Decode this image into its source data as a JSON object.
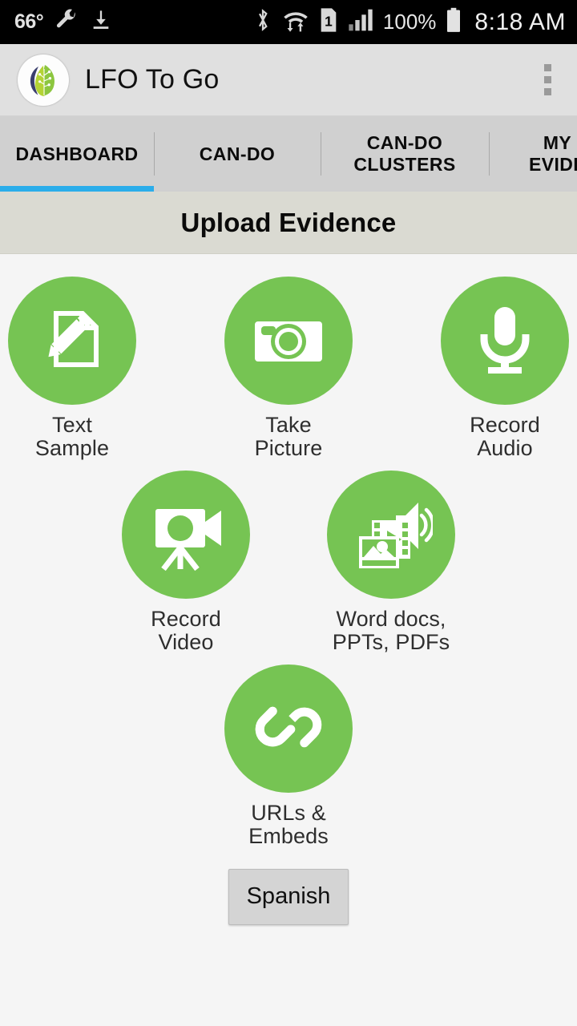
{
  "status_bar": {
    "temperature": "66°",
    "icons_left": [
      "wrench-icon",
      "download-icon"
    ],
    "icons_right": [
      "bluetooth-icon",
      "wifi-icon",
      "sim-1-icon",
      "signal-icon"
    ],
    "sim_label": "1",
    "battery_percent": "100%",
    "time": "8:18 AM"
  },
  "app_bar": {
    "title": "LFO To Go",
    "logo_name": "lfo-leaf-logo",
    "overflow_label": "More options"
  },
  "tabs": [
    {
      "label": "DASHBOARD",
      "active": true
    },
    {
      "label": "CAN-DO",
      "active": false
    },
    {
      "label": "CAN-DO CLUSTERS",
      "active": false
    },
    {
      "label": "MY EVIDE",
      "active": false
    }
  ],
  "tab_labels": {
    "dashboard": "DASHBOARD",
    "cando": "CAN-DO",
    "clusters_line1": "CAN-DO",
    "clusters_line2": "CLUSTERS",
    "evidence_line1": "MY",
    "evidence_line2": "EVIDE"
  },
  "section": {
    "title": "Upload Evidence"
  },
  "tiles": [
    {
      "id": "text-sample",
      "icon": "document-pencil-icon",
      "line1": "Text",
      "line2": "Sample"
    },
    {
      "id": "take-picture",
      "icon": "camera-icon",
      "line1": "Take",
      "line2": "Picture"
    },
    {
      "id": "record-audio",
      "icon": "microphone-icon",
      "line1": "Record",
      "line2": "Audio"
    },
    {
      "id": "record-video",
      "icon": "video-camera-icon",
      "line1": "Record",
      "line2": "Video"
    },
    {
      "id": "documents",
      "icon": "multimedia-files-icon",
      "line1": "Word docs,",
      "line2": "PPTs, PDFs"
    },
    {
      "id": "urls-embeds",
      "icon": "chain-link-icon",
      "line1": "URLs &",
      "line2": "Embeds"
    }
  ],
  "footer": {
    "language_button": "Spanish"
  },
  "colors": {
    "accent_green": "#76c453",
    "tab_indicator_blue": "#2badea",
    "app_bar_bg": "#e0e0e0",
    "tab_bar_bg": "#d0d0d0",
    "section_bg": "#dadad2",
    "content_bg": "#f5f5f5",
    "status_bar_bg": "#000000"
  }
}
